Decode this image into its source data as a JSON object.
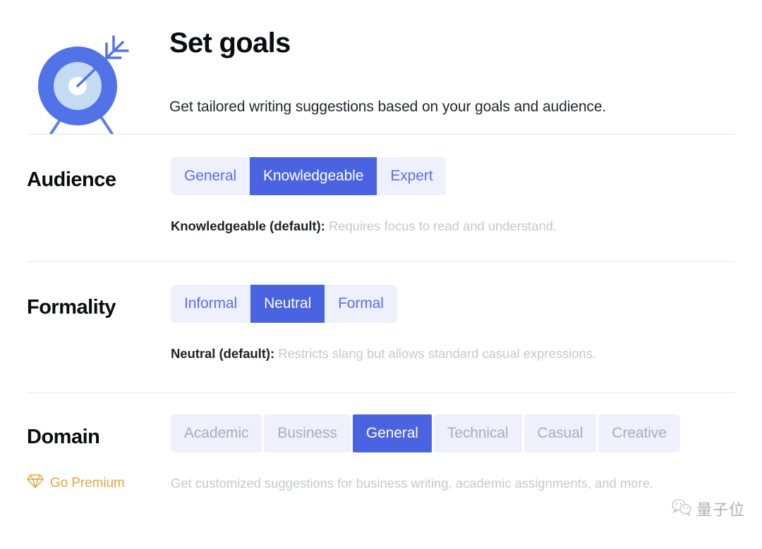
{
  "header": {
    "icon": "target-goal-icon",
    "title": "Set goals",
    "subtitle": "Get tailored writing suggestions based on your goals and audience."
  },
  "colors": {
    "accent_selected": "#4a63e0",
    "accent_text": "#5b6cf0",
    "segment_background": "#eef0fb",
    "disabled_text": "#a8adbd",
    "description_text": "#c6c8ce",
    "premium_gold": "#e2a63c",
    "divider": "#e7e8ec"
  },
  "settings": [
    {
      "label": "Audience",
      "options": [
        {
          "label": "General",
          "selected": false,
          "disabled": false
        },
        {
          "label": "Knowledgeable",
          "selected": true,
          "disabled": false
        },
        {
          "label": "Expert",
          "selected": false,
          "disabled": false
        }
      ],
      "description_strong": "Knowledgeable (default):",
      "description_rest": " Requires focus to read and understand."
    },
    {
      "label": "Formality",
      "options": [
        {
          "label": "Informal",
          "selected": false,
          "disabled": false
        },
        {
          "label": "Neutral",
          "selected": true,
          "disabled": false
        },
        {
          "label": "Formal",
          "selected": false,
          "disabled": false
        }
      ],
      "description_strong": "Neutral (default):",
      "description_rest": " Restricts slang but allows standard casual expressions."
    },
    {
      "label": "Domain",
      "options": [
        {
          "label": "Academic",
          "selected": false,
          "disabled": true
        },
        {
          "label": "Business",
          "selected": false,
          "disabled": true
        },
        {
          "label": "General",
          "selected": true,
          "disabled": false
        },
        {
          "label": "Technical",
          "selected": false,
          "disabled": true
        },
        {
          "label": "Casual",
          "selected": false,
          "disabled": true
        },
        {
          "label": "Creative",
          "selected": false,
          "disabled": true
        }
      ],
      "description_strong": "",
      "description_rest": ""
    }
  ],
  "premium": {
    "icon": "diamond-gem-icon",
    "label": "Go Premium",
    "description": "Get customized suggestions for business writing, academic assignments, and more."
  },
  "watermark": {
    "icon": "wechat-icon",
    "text": "量子位"
  }
}
